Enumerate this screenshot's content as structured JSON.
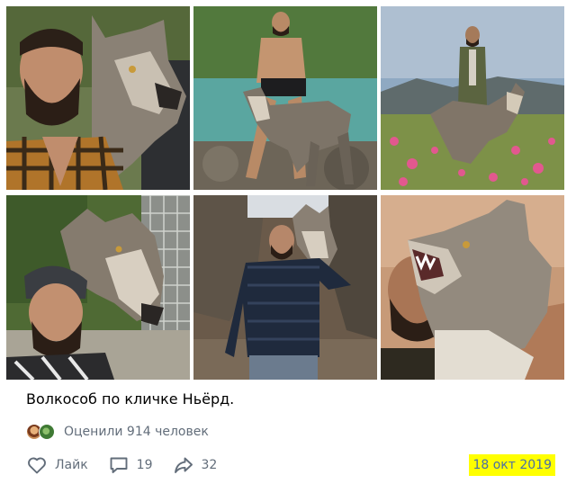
{
  "post": {
    "caption": "Волкособ по кличке Ньёрд.",
    "likes_summary": "Оценили 914 человек",
    "like_label": "Лайк",
    "comments_count": "19",
    "shares_count": "32",
    "date": "18 окт 2019"
  },
  "icons": {
    "like": "heart-icon",
    "comment": "comment-icon",
    "share": "share-icon"
  },
  "colors": {
    "action_gray": "#626d7a",
    "date_link": "#4a6fa5",
    "date_highlight": "#ffff00"
  }
}
